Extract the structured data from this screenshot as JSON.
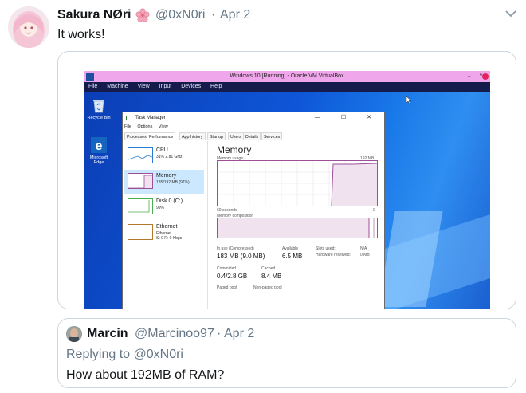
{
  "tweet": {
    "author_name": "Sakura NØri",
    "author_emoji": "cherry-blossom-icon",
    "handle": "@0xN0ri",
    "separator": "·",
    "date": "Apr 2",
    "text": "It works!"
  },
  "screenshot": {
    "vm_title": "Windows 10 [Running] - Oracle VM VirtualBox",
    "vm_menu": [
      "File",
      "Machine",
      "View",
      "Input",
      "Devices",
      "Help"
    ],
    "vm_window_controls": "⌄ ^ ",
    "desktop_icons": [
      {
        "label": "Recycle Bin",
        "icon": "recycle-bin-icon"
      },
      {
        "label": "Microsoft Edge",
        "icon": "edge-icon"
      }
    ],
    "task_manager": {
      "title": "Task Manager",
      "controls": "— ☐ ✕",
      "menu": [
        "File",
        "Options",
        "View"
      ],
      "tabs": [
        "Processes",
        "Performance",
        "App history",
        "Startup",
        "Users",
        "Details",
        "Services"
      ],
      "active_tab": "Performance",
      "sidebar": [
        {
          "title": "CPU",
          "sub": "31% 2.81 GHz",
          "sub2": ""
        },
        {
          "title": "Memory",
          "sub": "185/192 MB (97%)",
          "sub2": ""
        },
        {
          "title": "Disk 0 (C:)",
          "sub": "99%",
          "sub2": ""
        },
        {
          "title": "Ethernet",
          "sub": "Ethernet",
          "sub2": "S: 0 R: 0 Kbps"
        }
      ],
      "memory": {
        "heading": "Memory",
        "usage_label": "Memory usage",
        "usage_max": "192 MB",
        "axis_left": "60 seconds",
        "axis_right": "0",
        "composition_label": "Memory composition",
        "in_use_label": "In use (Compressed)",
        "in_use_value": "183 MB (9.0 MB)",
        "available_label": "Available",
        "available_value": "6.5 MB",
        "slots_label": "Slots used:",
        "slots_value": "N/A",
        "hw_reserved_label": "Hardware reserved:",
        "hw_reserved_value": "0 MB",
        "committed_label": "Committed",
        "committed_value": "0.4/2.8 GB",
        "cached_label": "Cached",
        "cached_value": "8.4 MB",
        "paged_label": "Paged pool",
        "nonpaged_label": "Non-paged pool"
      }
    }
  },
  "quote": {
    "name": "Marcin",
    "handle": "@Marcinoo97",
    "separator": "·",
    "date": "Apr 2",
    "replying_prefix": "Replying to",
    "replying_handle": "@0xN0ri",
    "text": "How about 192MB of RAM?"
  },
  "colors": {
    "link_gray": "#657786",
    "text": "#14171a",
    "vm_title_bar": "#f0a6ea",
    "memory_accent": "#9b4f96",
    "desktop_blue": "#0e56d8"
  }
}
